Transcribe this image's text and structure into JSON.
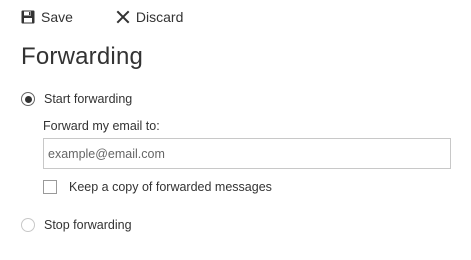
{
  "toolbar": {
    "save_label": "Save",
    "save_icon": "floppy-disk-icon",
    "discard_label": "Discard",
    "discard_icon": "x-icon"
  },
  "page": {
    "title": "Forwarding"
  },
  "options": {
    "start_label": "Start forwarding",
    "start_selected": true,
    "forward_to_label": "Forward my email to:",
    "email_value": "",
    "email_placeholder": "example@email.com",
    "keep_copy_label": "Keep a copy of forwarded messages",
    "keep_copy_checked": false,
    "stop_label": "Stop forwarding",
    "stop_selected": false
  },
  "colors": {
    "text": "#333333",
    "border": "#c8c8c8"
  }
}
